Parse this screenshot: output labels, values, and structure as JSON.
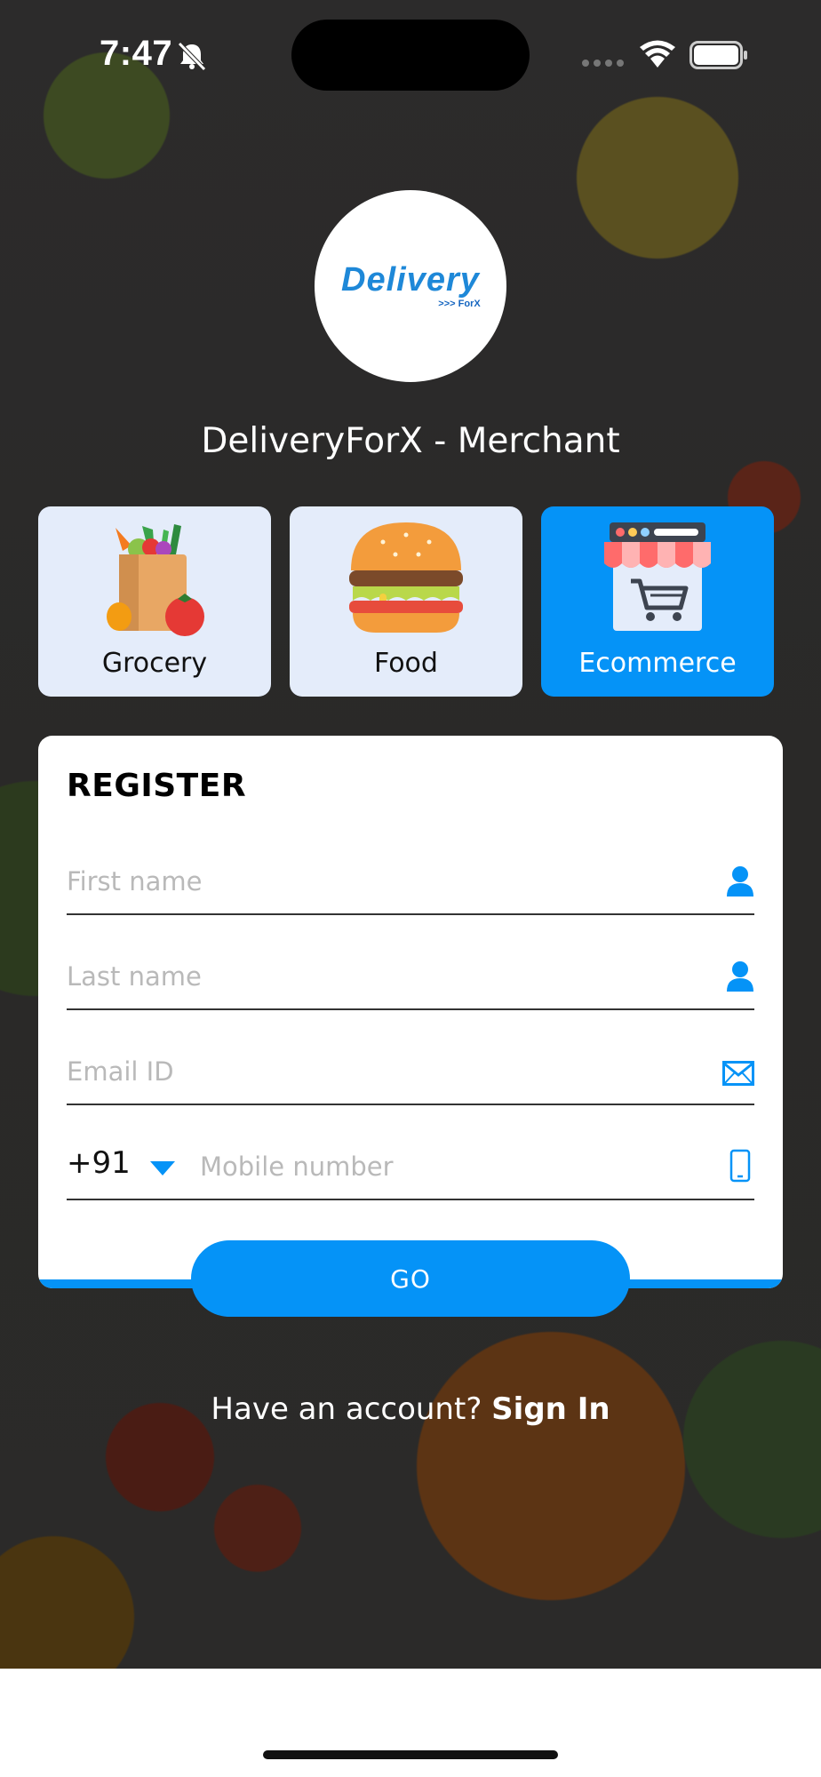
{
  "status_bar": {
    "time": "7:47"
  },
  "app": {
    "logo_text": "Delivery",
    "logo_sub": ">>> ForX",
    "title": "DeliveryForX - Merchant"
  },
  "categories": [
    {
      "label": "Grocery",
      "active": false,
      "icon": "grocery-bag-icon"
    },
    {
      "label": "Food",
      "active": false,
      "icon": "burger-icon"
    },
    {
      "label": "Ecommerce",
      "active": true,
      "icon": "shop-cart-icon"
    }
  ],
  "register": {
    "title": "REGISTER",
    "first_name_placeholder": "First name",
    "last_name_placeholder": "Last name",
    "email_placeholder": "Email ID",
    "phone_code": "+91",
    "mobile_placeholder": "Mobile number",
    "go_label": "GO"
  },
  "footer": {
    "have_account": "Have an account?",
    "sign_in": "Sign In"
  },
  "colors": {
    "accent": "#0593f7",
    "card_inactive": "#e4ecfa",
    "placeholder": "#b9b9b9"
  }
}
